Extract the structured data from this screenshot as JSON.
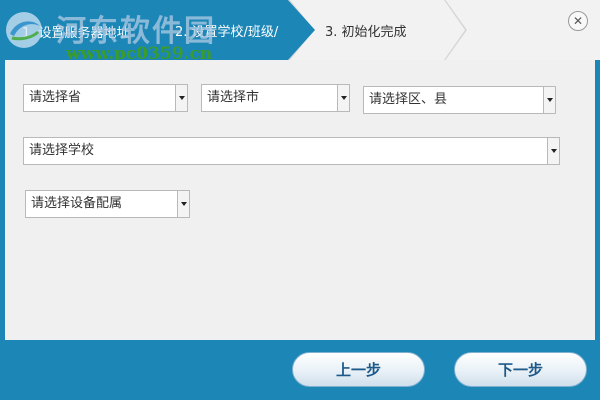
{
  "steps": [
    {
      "label": "1. 设置服务器地址"
    },
    {
      "label": "2. 设置学校/班级/"
    },
    {
      "label": "3. 初始化完成"
    }
  ],
  "watermark": {
    "title": "河东软件园",
    "url": "www.pc0359.cn"
  },
  "close": {
    "symbol": "✕"
  },
  "form": {
    "province": {
      "value": "请选择省"
    },
    "city": {
      "value": "请选择市"
    },
    "district": {
      "value": "请选择区、县"
    },
    "school": {
      "value": "请选择学校"
    },
    "device": {
      "value": "请选择设备配属"
    }
  },
  "footer": {
    "prev_label": "上一步",
    "next_label": "下一步"
  },
  "colors": {
    "accent_blue": "#1c86b7",
    "content_bg": "#f0f0f0"
  }
}
